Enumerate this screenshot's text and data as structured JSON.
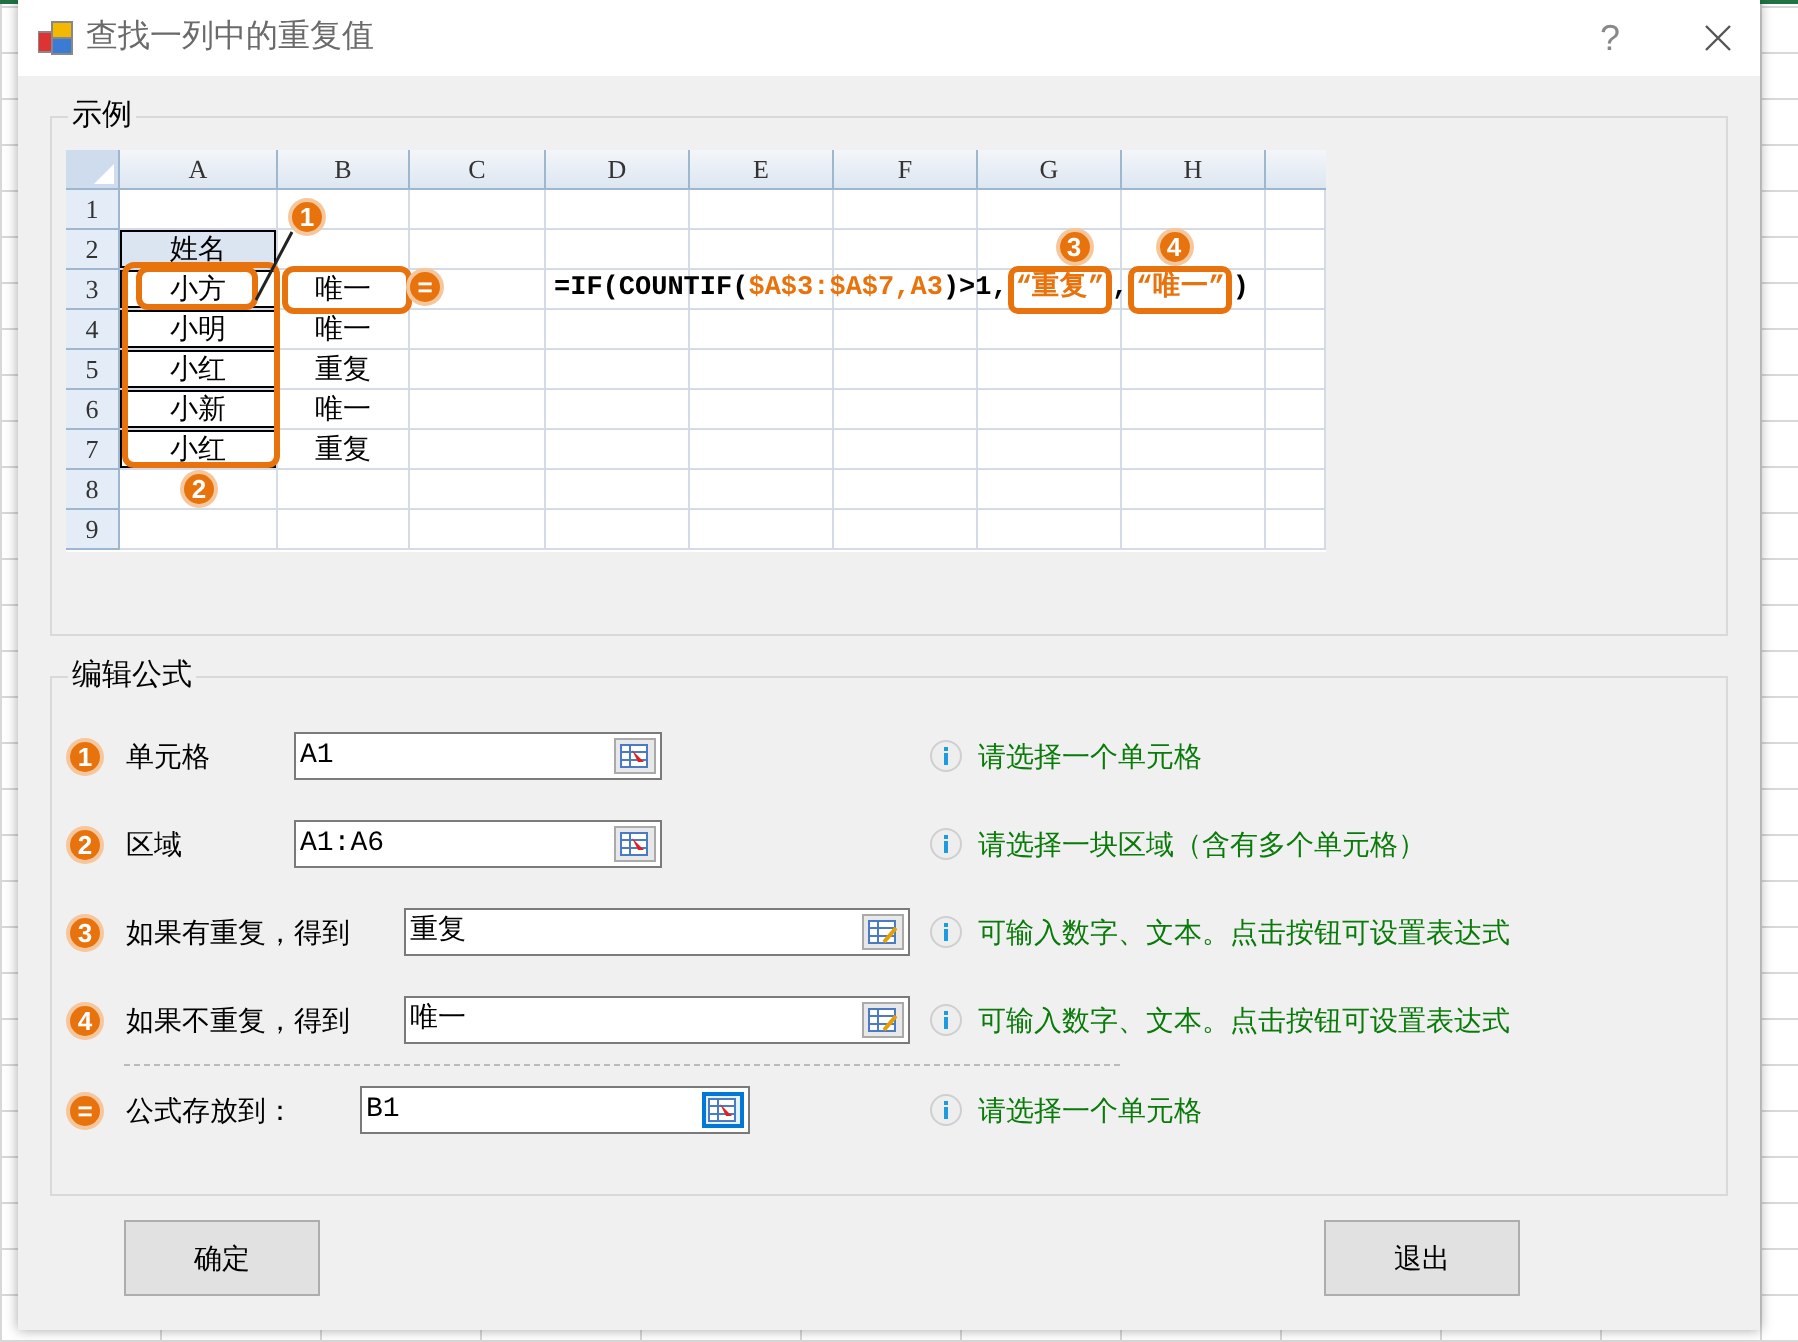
{
  "window": {
    "title": "查找一列中的重复值",
    "help": "?"
  },
  "example": {
    "title": "示例",
    "sheet": {
      "columns": [
        "A",
        "B",
        "C",
        "D",
        "E",
        "F",
        "G",
        "H"
      ],
      "rows": [
        {
          "number": "1",
          "cells": []
        },
        {
          "number": "2",
          "cells": [
            {
              "text": "姓名",
              "kind": "header"
            }
          ]
        },
        {
          "number": "3",
          "cells": [
            {
              "text": "小方",
              "kind": "bordered"
            },
            {
              "text": "唯一",
              "kind": "plain"
            }
          ]
        },
        {
          "number": "4",
          "cells": [
            {
              "text": "小明",
              "kind": "bordered"
            },
            {
              "text": "唯一",
              "kind": "plain"
            }
          ]
        },
        {
          "number": "5",
          "cells": [
            {
              "text": "小红",
              "kind": "bordered"
            },
            {
              "text": "重复",
              "kind": "plain"
            }
          ]
        },
        {
          "number": "6",
          "cells": [
            {
              "text": "小新",
              "kind": "bordered"
            },
            {
              "text": "唯一",
              "kind": "plain"
            }
          ]
        },
        {
          "number": "7",
          "cells": [
            {
              "text": "小红",
              "kind": "bordered"
            },
            {
              "text": "重复",
              "kind": "plain"
            }
          ]
        },
        {
          "number": "8",
          "cells": []
        },
        {
          "number": "9",
          "cells": []
        }
      ]
    },
    "callouts": [
      {
        "badge": "1"
      },
      {
        "badge": "2"
      },
      {
        "badge": "="
      }
    ],
    "formula": [
      {
        "text": "=IF(COUNTIF(",
        "kind": "plain"
      },
      {
        "text": "$A$3:$A$7,A3",
        "kind": "orange"
      },
      {
        "text": ")>1,",
        "kind": "plain"
      },
      {
        "text": "“重复”",
        "kind": "boxed",
        "badge": "3"
      },
      {
        "text": ",",
        "kind": "plain"
      },
      {
        "text": "“唯一”",
        "kind": "boxed",
        "badge": "4"
      },
      {
        "text": ")",
        "kind": "plain"
      }
    ]
  },
  "edit": {
    "title": "编辑公式",
    "rows": [
      {
        "badge": "1",
        "label": "单元格",
        "value": "A1",
        "kind": "reference",
        "focused": false,
        "hint": "请选择一个单元格"
      },
      {
        "badge": "2",
        "label": "区域",
        "value": "A1:A6",
        "kind": "reference",
        "focused": false,
        "hint": "请选择一块区域（含有多个单元格）"
      },
      {
        "badge": "3",
        "label": "如果有重复，得到",
        "value": "重复",
        "kind": "value",
        "focused": false,
        "hint": "可输入数字、文本。点击按钮可设置表达式"
      },
      {
        "badge": "4",
        "label": "如果不重复，得到",
        "value": "唯一",
        "kind": "value",
        "focused": false,
        "hint": "可输入数字、文本。点击按钮可设置表达式"
      },
      {
        "badge": "=",
        "label": "公式存放到：",
        "value": "B1",
        "kind": "output",
        "focused": true,
        "hint": "请选择一个单元格"
      }
    ]
  },
  "buttons": [
    {
      "label": "确定"
    },
    {
      "label": "退出"
    }
  ]
}
